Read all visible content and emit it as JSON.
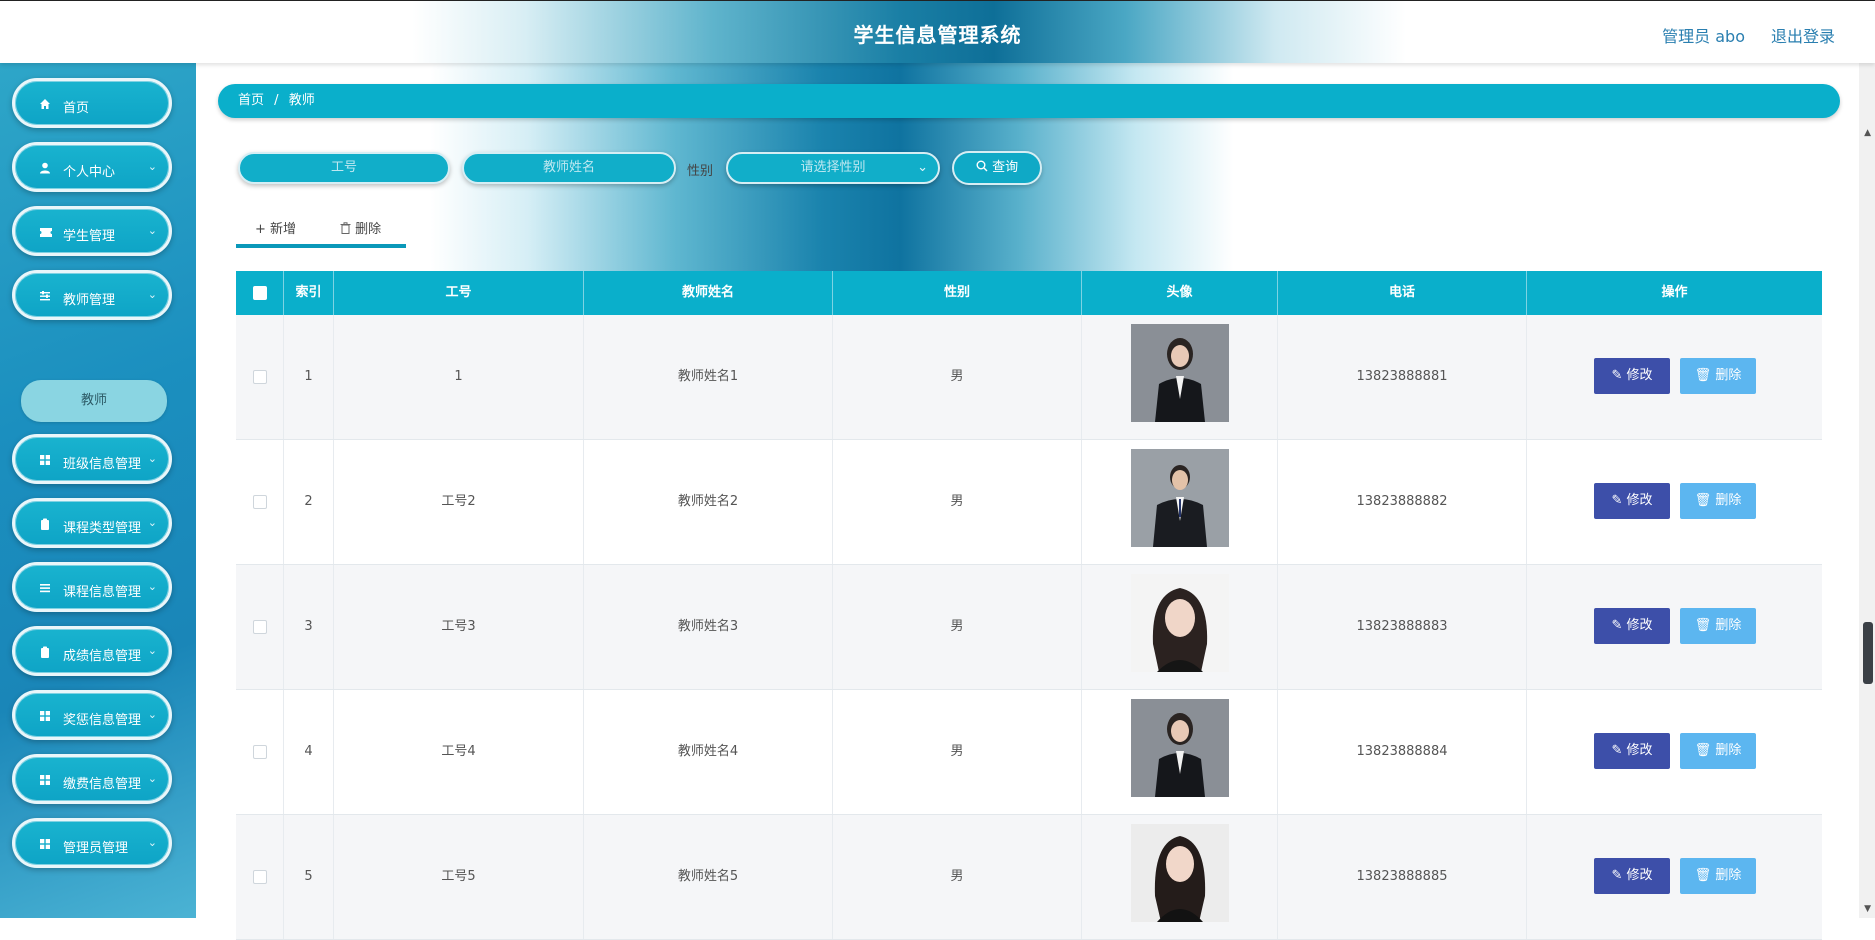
{
  "header": {
    "title": "学生信息管理系统",
    "admin": "管理员 abo",
    "logout": "退出登录"
  },
  "sidebar": {
    "items": [
      {
        "label": "首页",
        "icon": "home-icon"
      },
      {
        "label": "个人中心",
        "icon": "user-icon"
      },
      {
        "label": "学生管理",
        "icon": "ticket-icon"
      },
      {
        "label": "教师管理",
        "icon": "sliders-icon"
      },
      {
        "label": "班级信息管理",
        "icon": "grid-icon"
      },
      {
        "label": "课程类型管理",
        "icon": "clipboard-icon"
      },
      {
        "label": "课程信息管理",
        "icon": "list-icon"
      },
      {
        "label": "成绩信息管理",
        "icon": "clipboard-icon"
      },
      {
        "label": "奖惩信息管理",
        "icon": "grid-icon"
      },
      {
        "label": "缴费信息管理",
        "icon": "grid-icon"
      },
      {
        "label": "管理员管理",
        "icon": "grid-icon"
      }
    ],
    "sub_item": "教师"
  },
  "breadcrumb": {
    "home": "首页",
    "sep": "/",
    "current": "教师"
  },
  "search": {
    "job_no_placeholder": "工号",
    "name_placeholder": "教师姓名",
    "gender_label": "性别",
    "gender_placeholder": "请选择性别",
    "search_button": "查询"
  },
  "actions": {
    "add": "新增",
    "delete": "删除"
  },
  "table": {
    "headers": [
      "索引",
      "工号",
      "教师姓名",
      "性别",
      "头像",
      "电话",
      "操作"
    ],
    "rows": [
      {
        "index": "1",
        "job_no": "1",
        "name": "教师姓名1",
        "gender": "男",
        "phone": "13823888881",
        "edit": "修改",
        "delete": "删除"
      },
      {
        "index": "2",
        "job_no": "工号2",
        "name": "教师姓名2",
        "gender": "男",
        "phone": "13823888882",
        "edit": "修改",
        "delete": "删除"
      },
      {
        "index": "3",
        "job_no": "工号3",
        "name": "教师姓名3",
        "gender": "男",
        "phone": "13823888883",
        "edit": "修改",
        "delete": "删除"
      },
      {
        "index": "4",
        "job_no": "工号4",
        "name": "教师姓名4",
        "gender": "男",
        "phone": "13823888884",
        "edit": "修改",
        "delete": "删除"
      },
      {
        "index": "5",
        "job_no": "工号5",
        "name": "教师姓名5",
        "gender": "男",
        "phone": "13823888885",
        "edit": "修改",
        "delete": "删除"
      }
    ]
  },
  "colors": {
    "accent": "#0aafcb",
    "edit": "#3d4fa9",
    "delete": "#5cb6f0"
  }
}
